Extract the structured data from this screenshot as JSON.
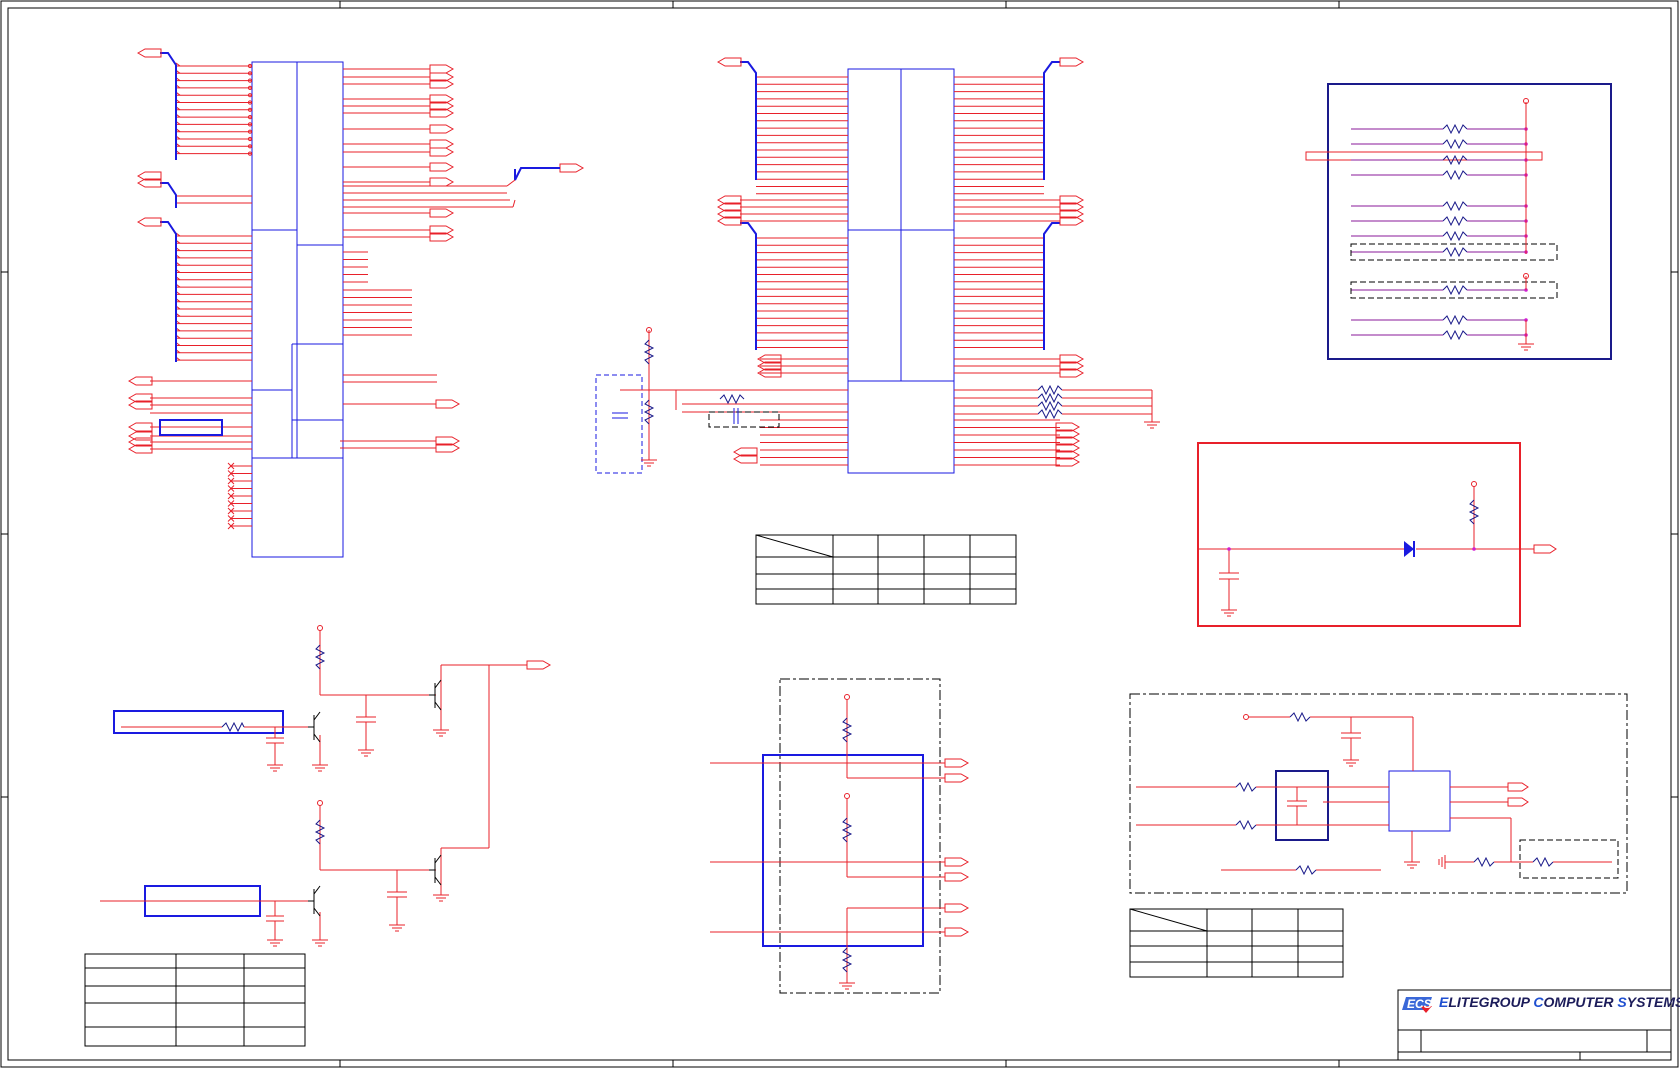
{
  "title_block": {
    "logo": "ECS",
    "company": {
      "e": "E",
      "rest1": "LITEGROUP ",
      "c": "C",
      "rest2": "OMPUTER ",
      "s": "S",
      "rest3": "YSTEMS"
    }
  },
  "colors": {
    "wire": "#e8202a",
    "net": "#8a1a9a",
    "part": "#1a1ae0",
    "frame": "#000000",
    "junction": "#d020d0",
    "highlight_red": "#e8202a",
    "highlight_navy": "#1a1a8a"
  },
  "icons": [
    "ecs-logo-icon",
    "resistor-icon",
    "capacitor-icon",
    "transistor-icon",
    "diode-icon",
    "ground-icon",
    "power-pin-icon",
    "off-page-connector-icon"
  ]
}
